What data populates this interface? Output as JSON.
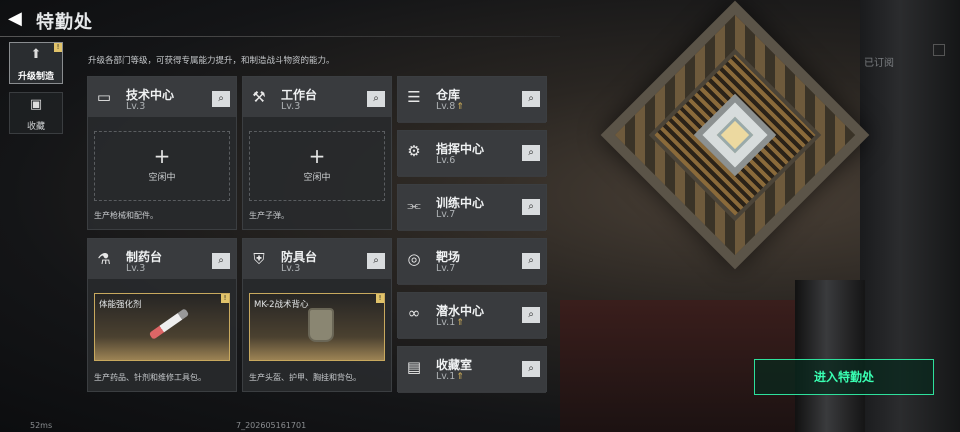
{
  "header": {
    "title": "特勤处"
  },
  "side_tabs": [
    {
      "label": "升级制造",
      "active": true,
      "badge": "!"
    },
    {
      "label": "收藏",
      "active": false
    }
  ],
  "description": "升级各部门等级，可获得专属能力提升，和制造战斗物资的能力。",
  "subscribed_label": "已订阅",
  "cards": {
    "tech": {
      "name": "技术中心",
      "level": "Lv.3",
      "slot": "空闲中",
      "footer": "生产枪械和配件。",
      "icon": "monitor-icon"
    },
    "workbench": {
      "name": "工作台",
      "level": "Lv.3",
      "slot": "空闲中",
      "footer": "生产子弹。",
      "icon": "hammer-icon"
    },
    "pharmacy": {
      "name": "制药台",
      "level": "Lv.3",
      "product": "体能强化剂",
      "footer": "生产药品、针剂和维修工具包。",
      "icon": "microscope-icon"
    },
    "armor": {
      "name": "防具台",
      "level": "Lv.3",
      "product": "MK-2战术背心",
      "footer": "生产头盔、护甲、胸挂和背包。",
      "icon": "armor-icon"
    },
    "warehouse": {
      "name": "仓库",
      "level": "Lv.8",
      "upgradable": true,
      "icon": "storage-icon"
    },
    "command": {
      "name": "指挥中心",
      "level": "Lv.6",
      "icon": "chip-icon"
    },
    "training": {
      "name": "训练中心",
      "level": "Lv.7",
      "icon": "dumbbell-icon"
    },
    "range": {
      "name": "靶场",
      "level": "Lv.7",
      "icon": "target-icon"
    },
    "diving": {
      "name": "潜水中心",
      "level": "Lv.1",
      "upgradable": true,
      "icon": "goggles-icon"
    },
    "collection": {
      "name": "收藏室",
      "level": "Lv.1",
      "upgradable": true,
      "icon": "cabinet-icon"
    }
  },
  "enter_button": "进入特勤处",
  "status": {
    "ping": "52ms",
    "uid": "7_202605161701"
  },
  "colors": {
    "accent": "#39ffb2",
    "gold": "#e1c36a"
  }
}
